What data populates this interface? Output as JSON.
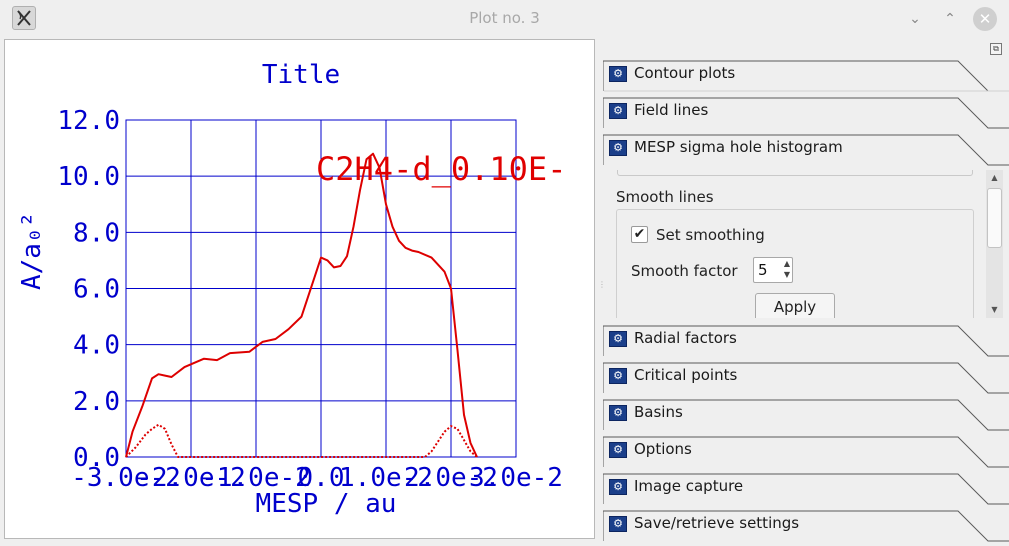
{
  "window": {
    "title": "Plot no. 3",
    "controls": {
      "minimize": "⌄",
      "maximize": "⌃",
      "close": "✕"
    }
  },
  "colors": {
    "plot_axes": "#0000cc",
    "plot_series": "#dd0000",
    "tab_icon": "#1b3f8a"
  },
  "chart_data": {
    "type": "line",
    "title": "Title",
    "xlabel": "MESP / au",
    "ylabel": "A/a₀²",
    "annotation": "C2H4-d_0.10E-",
    "xlim": [
      -0.03,
      0.03
    ],
    "ylim": [
      0.0,
      12.0
    ],
    "yticks": [
      "0.0",
      "2.0",
      "4.0",
      "6.0",
      "8.0",
      "10.0",
      "12.0"
    ],
    "xticks": [
      "-3.0e-2",
      "-2.0e-2",
      "-1.0e-2",
      "0.0",
      "1.0e-2",
      "2.0e-2",
      "3.0e-2"
    ],
    "grid": true,
    "series": [
      {
        "style": "solid",
        "x": [
          -0.03,
          -0.029,
          -0.0275,
          -0.026,
          -0.025,
          -0.024,
          -0.023,
          -0.021,
          -0.018,
          -0.016,
          -0.014,
          -0.011,
          -0.009,
          -0.007,
          -0.005,
          -0.003,
          -0.001,
          0.0,
          0.001,
          0.002,
          0.003,
          0.004,
          0.005,
          0.006,
          0.007,
          0.008,
          0.009,
          0.01,
          0.011,
          0.012,
          0.013,
          0.014,
          0.015,
          0.017,
          0.019,
          0.02,
          0.021,
          0.022,
          0.023,
          0.024
        ],
        "y": [
          0.0,
          0.9,
          1.8,
          2.8,
          2.95,
          2.9,
          2.85,
          3.2,
          3.5,
          3.45,
          3.7,
          3.75,
          4.1,
          4.2,
          4.55,
          5.0,
          6.4,
          7.1,
          7.0,
          6.75,
          6.8,
          7.15,
          8.2,
          9.5,
          10.6,
          10.8,
          10.3,
          9.0,
          8.2,
          7.7,
          7.45,
          7.35,
          7.3,
          7.1,
          6.6,
          6.0,
          3.8,
          1.5,
          0.5,
          0.0
        ]
      },
      {
        "style": "dotted",
        "x": [
          -0.03,
          -0.0285,
          -0.027,
          -0.026,
          -0.025,
          -0.024,
          -0.023,
          -0.022,
          0.016,
          0.017,
          0.018,
          0.019,
          0.02,
          0.021,
          0.022,
          0.023,
          0.024
        ],
        "y": [
          0.0,
          0.35,
          0.8,
          1.0,
          1.15,
          1.0,
          0.45,
          0.0,
          0.0,
          0.2,
          0.55,
          0.9,
          1.1,
          1.0,
          0.6,
          0.2,
          0.0
        ]
      }
    ]
  },
  "sidepanel": {
    "tabs_top": [
      {
        "label": "Contour plots"
      },
      {
        "label": "Field lines"
      },
      {
        "label": "MESP sigma hole histogram"
      }
    ],
    "mesp": {
      "section_title": "Smooth lines",
      "checkbox_label": "Set smoothing",
      "checkbox_mark": "✔",
      "factor_label": "Smooth factor",
      "factor_value": "5",
      "apply_label": "Apply"
    },
    "tabs_bottom": [
      {
        "label": "Radial factors"
      },
      {
        "label": "Critical points"
      },
      {
        "label": "Basins"
      },
      {
        "label": "Options"
      },
      {
        "label": "Image capture"
      },
      {
        "label": "Save/retrieve settings"
      }
    ]
  }
}
